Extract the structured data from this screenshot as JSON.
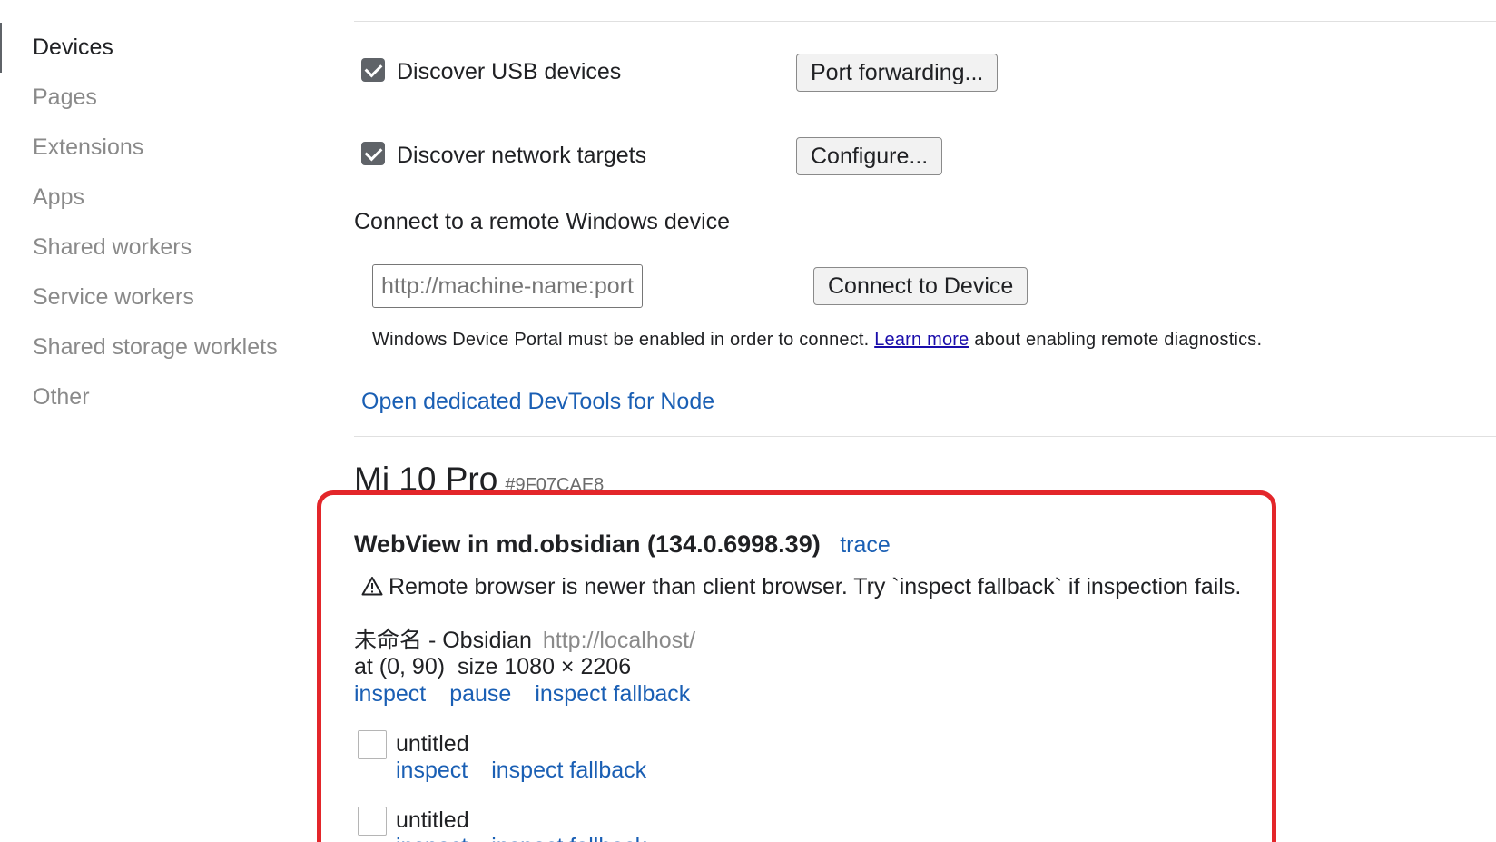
{
  "sidebar": {
    "items": [
      {
        "label": "Devices",
        "active": true
      },
      {
        "label": "Pages"
      },
      {
        "label": "Extensions"
      },
      {
        "label": "Apps"
      },
      {
        "label": "Shared workers"
      },
      {
        "label": "Service workers"
      },
      {
        "label": "Shared storage worklets"
      },
      {
        "label": "Other"
      }
    ]
  },
  "settings": {
    "discover_usb": {
      "label": "Discover USB devices",
      "checked": true,
      "button": "Port forwarding..."
    },
    "discover_network": {
      "label": "Discover network targets",
      "checked": true,
      "button": "Configure..."
    },
    "remote_windows": {
      "heading": "Connect to a remote Windows device",
      "input_placeholder": "http://machine-name:port",
      "button": "Connect to Device",
      "hint_before": "Windows Device Portal must be enabled in order to connect.",
      "hint_link": "Learn more",
      "hint_after": "about enabling remote diagnostics."
    },
    "node_link": "Open dedicated DevTools for Node"
  },
  "device": {
    "name": "Mi 10 Pro",
    "serial": "#9F07CAE8",
    "browser": {
      "title": "WebView in md.obsidian (134.0.6998.39)",
      "trace_link": "trace",
      "warning": "Remote browser is newer than client browser. Try `inspect fallback` if inspection fails.",
      "pages": [
        {
          "title": "未命名 - Obsidian",
          "url": "http://localhost/",
          "position": "at (0, 90)",
          "size": "size 1080 × 2206",
          "actions": [
            "inspect",
            "pause",
            "inspect fallback"
          ]
        }
      ],
      "subtargets": [
        {
          "title": "untitled",
          "actions": [
            "inspect",
            "inspect fallback"
          ]
        },
        {
          "title": "untitled",
          "actions": [
            "inspect",
            "inspect fallback"
          ]
        }
      ]
    }
  },
  "colors": {
    "link": "#1a5fb4",
    "highlight": "#e3262a",
    "muted": "#8a8a8a"
  }
}
